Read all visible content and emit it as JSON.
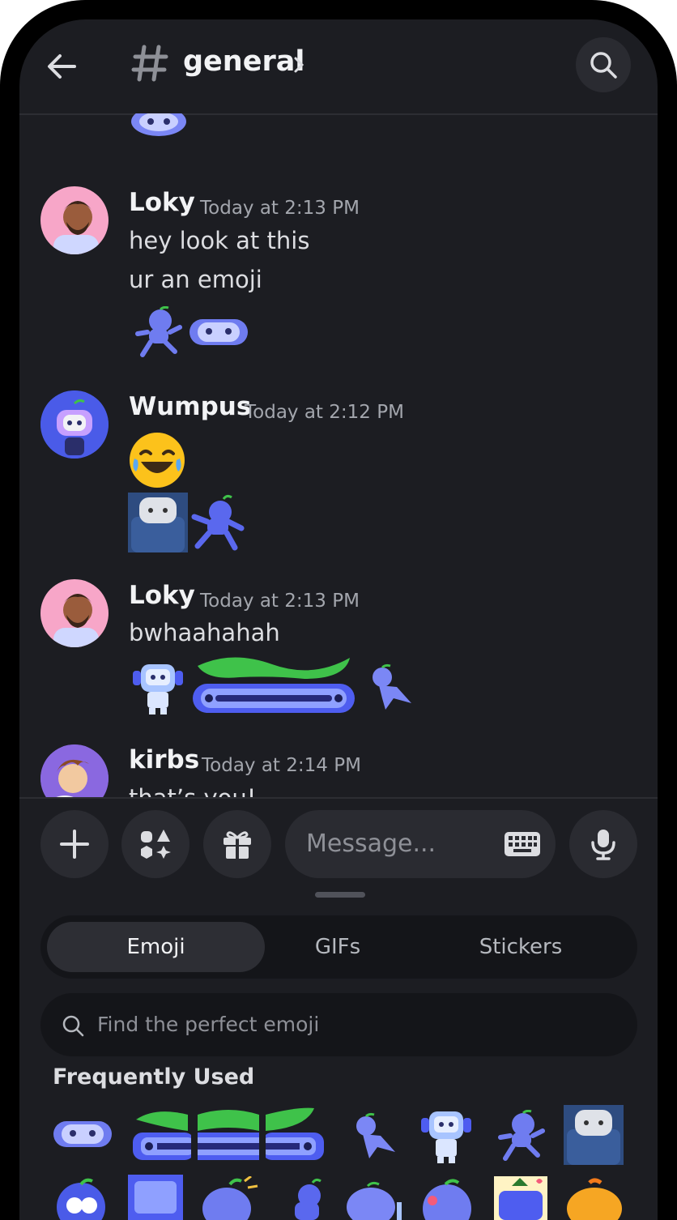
{
  "channel": {
    "name": "general"
  },
  "messages": [
    {
      "author": "Loky",
      "time": "Today at 2:13 PM",
      "lines": [
        "hey look at this",
        "ur an emoji"
      ]
    },
    {
      "author": "Wumpus",
      "time": "Today at 2:12 PM",
      "lines": []
    },
    {
      "author": "Loky",
      "time": "Today at 2:13 PM",
      "lines": [
        "bwhaahahah"
      ]
    },
    {
      "author": "kirbs",
      "time": "Today at 2:14 PM",
      "lines": [
        "that’s you!"
      ]
    }
  ],
  "composer": {
    "placeholder": "Message..."
  },
  "picker": {
    "tabs": [
      "Emoji",
      "GIFs",
      "Stickers"
    ],
    "active_tab": "Emoji",
    "search_placeholder": "Find the perfect emoji",
    "section_title": "Frequently Used"
  },
  "colors": {
    "background": "#1c1d22",
    "wumpus_blue": "#5865f2",
    "leaf_green": "#3fc24a",
    "text": "#f2f3f5",
    "muted": "#a3a6ad"
  }
}
